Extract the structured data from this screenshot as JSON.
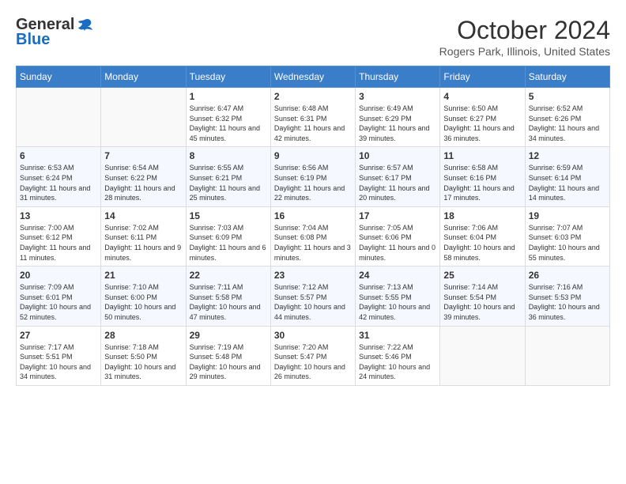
{
  "header": {
    "logo_general": "General",
    "logo_blue": "Blue",
    "month": "October 2024",
    "location": "Rogers Park, Illinois, United States"
  },
  "weekdays": [
    "Sunday",
    "Monday",
    "Tuesday",
    "Wednesday",
    "Thursday",
    "Friday",
    "Saturday"
  ],
  "weeks": [
    [
      {
        "day": "",
        "info": ""
      },
      {
        "day": "",
        "info": ""
      },
      {
        "day": "1",
        "info": "Sunrise: 6:47 AM\nSunset: 6:32 PM\nDaylight: 11 hours and 45 minutes."
      },
      {
        "day": "2",
        "info": "Sunrise: 6:48 AM\nSunset: 6:31 PM\nDaylight: 11 hours and 42 minutes."
      },
      {
        "day": "3",
        "info": "Sunrise: 6:49 AM\nSunset: 6:29 PM\nDaylight: 11 hours and 39 minutes."
      },
      {
        "day": "4",
        "info": "Sunrise: 6:50 AM\nSunset: 6:27 PM\nDaylight: 11 hours and 36 minutes."
      },
      {
        "day": "5",
        "info": "Sunrise: 6:52 AM\nSunset: 6:26 PM\nDaylight: 11 hours and 34 minutes."
      }
    ],
    [
      {
        "day": "6",
        "info": "Sunrise: 6:53 AM\nSunset: 6:24 PM\nDaylight: 11 hours and 31 minutes."
      },
      {
        "day": "7",
        "info": "Sunrise: 6:54 AM\nSunset: 6:22 PM\nDaylight: 11 hours and 28 minutes."
      },
      {
        "day": "8",
        "info": "Sunrise: 6:55 AM\nSunset: 6:21 PM\nDaylight: 11 hours and 25 minutes."
      },
      {
        "day": "9",
        "info": "Sunrise: 6:56 AM\nSunset: 6:19 PM\nDaylight: 11 hours and 22 minutes."
      },
      {
        "day": "10",
        "info": "Sunrise: 6:57 AM\nSunset: 6:17 PM\nDaylight: 11 hours and 20 minutes."
      },
      {
        "day": "11",
        "info": "Sunrise: 6:58 AM\nSunset: 6:16 PM\nDaylight: 11 hours and 17 minutes."
      },
      {
        "day": "12",
        "info": "Sunrise: 6:59 AM\nSunset: 6:14 PM\nDaylight: 11 hours and 14 minutes."
      }
    ],
    [
      {
        "day": "13",
        "info": "Sunrise: 7:00 AM\nSunset: 6:12 PM\nDaylight: 11 hours and 11 minutes."
      },
      {
        "day": "14",
        "info": "Sunrise: 7:02 AM\nSunset: 6:11 PM\nDaylight: 11 hours and 9 minutes."
      },
      {
        "day": "15",
        "info": "Sunrise: 7:03 AM\nSunset: 6:09 PM\nDaylight: 11 hours and 6 minutes."
      },
      {
        "day": "16",
        "info": "Sunrise: 7:04 AM\nSunset: 6:08 PM\nDaylight: 11 hours and 3 minutes."
      },
      {
        "day": "17",
        "info": "Sunrise: 7:05 AM\nSunset: 6:06 PM\nDaylight: 11 hours and 0 minutes."
      },
      {
        "day": "18",
        "info": "Sunrise: 7:06 AM\nSunset: 6:04 PM\nDaylight: 10 hours and 58 minutes."
      },
      {
        "day": "19",
        "info": "Sunrise: 7:07 AM\nSunset: 6:03 PM\nDaylight: 10 hours and 55 minutes."
      }
    ],
    [
      {
        "day": "20",
        "info": "Sunrise: 7:09 AM\nSunset: 6:01 PM\nDaylight: 10 hours and 52 minutes."
      },
      {
        "day": "21",
        "info": "Sunrise: 7:10 AM\nSunset: 6:00 PM\nDaylight: 10 hours and 50 minutes."
      },
      {
        "day": "22",
        "info": "Sunrise: 7:11 AM\nSunset: 5:58 PM\nDaylight: 10 hours and 47 minutes."
      },
      {
        "day": "23",
        "info": "Sunrise: 7:12 AM\nSunset: 5:57 PM\nDaylight: 10 hours and 44 minutes."
      },
      {
        "day": "24",
        "info": "Sunrise: 7:13 AM\nSunset: 5:55 PM\nDaylight: 10 hours and 42 minutes."
      },
      {
        "day": "25",
        "info": "Sunrise: 7:14 AM\nSunset: 5:54 PM\nDaylight: 10 hours and 39 minutes."
      },
      {
        "day": "26",
        "info": "Sunrise: 7:16 AM\nSunset: 5:53 PM\nDaylight: 10 hours and 36 minutes."
      }
    ],
    [
      {
        "day": "27",
        "info": "Sunrise: 7:17 AM\nSunset: 5:51 PM\nDaylight: 10 hours and 34 minutes."
      },
      {
        "day": "28",
        "info": "Sunrise: 7:18 AM\nSunset: 5:50 PM\nDaylight: 10 hours and 31 minutes."
      },
      {
        "day": "29",
        "info": "Sunrise: 7:19 AM\nSunset: 5:48 PM\nDaylight: 10 hours and 29 minutes."
      },
      {
        "day": "30",
        "info": "Sunrise: 7:20 AM\nSunset: 5:47 PM\nDaylight: 10 hours and 26 minutes."
      },
      {
        "day": "31",
        "info": "Sunrise: 7:22 AM\nSunset: 5:46 PM\nDaylight: 10 hours and 24 minutes."
      },
      {
        "day": "",
        "info": ""
      },
      {
        "day": "",
        "info": ""
      }
    ]
  ]
}
